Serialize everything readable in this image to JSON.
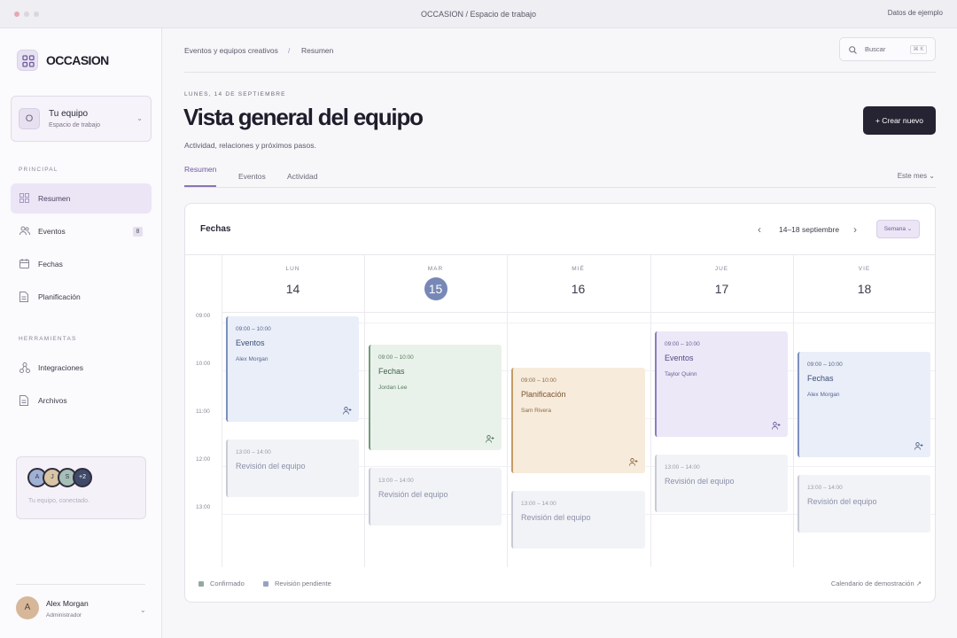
{
  "window": {
    "title": "OCCASION / Espacio de trabajo",
    "right_label": "Datos de ejemplo"
  },
  "sidebar": {
    "logo": "OCCASION",
    "team": {
      "initial": "O",
      "name": "Tu equipo",
      "sub": "Espacio de trabajo"
    },
    "section_principal": "PRINCIPAL",
    "section_tools": "HERRAMIENTAS",
    "items": [
      {
        "label": "Resumen",
        "icon": "grid-icon",
        "active": true
      },
      {
        "label": "Eventos",
        "icon": "users-icon",
        "badge": "8"
      },
      {
        "label": "Fechas",
        "icon": "calendar-icon"
      },
      {
        "label": "Planificación",
        "icon": "document-icon"
      }
    ],
    "tools": [
      {
        "label": "Integraciones",
        "icon": "network-icon"
      },
      {
        "label": "Archivos",
        "icon": "file-icon"
      }
    ],
    "promo": {
      "avatars": [
        "A",
        "J",
        "S",
        "+2"
      ],
      "text": "Tu equipo, conectado."
    },
    "user": {
      "initial": "A",
      "name": "Alex Morgan",
      "role": "Administrador"
    }
  },
  "header": {
    "breadcrumb": [
      "Eventos y equipos creativos",
      "/",
      "Resumen"
    ],
    "search_label": "Buscar",
    "search_kbd": "⌘ K",
    "date": "LUNES, 14 DE SEPTIEMBRE",
    "title": "Vista general del equipo",
    "subtitle": "Actividad, relaciones y próximos pasos.",
    "cta": "+ Crear nuevo"
  },
  "tabs": [
    {
      "label": "Resumen",
      "active": true
    },
    {
      "label": "Eventos"
    },
    {
      "label": "Actividad"
    }
  ],
  "period": "Este mes ⌄",
  "calendar": {
    "title": "Fechas",
    "range": "14–18 septiembre",
    "view": "Semana ⌄",
    "days": [
      {
        "name": "LUN",
        "num": "14"
      },
      {
        "name": "MAR",
        "num": "15",
        "today": true
      },
      {
        "name": "MIÉ",
        "num": "16"
      },
      {
        "name": "JUE",
        "num": "17"
      },
      {
        "name": "VIE",
        "num": "18"
      }
    ],
    "times": [
      "09:00",
      "10:00",
      "11:00",
      "12:00",
      "13:00"
    ],
    "events": [
      {
        "time": "09:00 – 10:00",
        "name": "Eventos",
        "person": "Alex Morgan"
      },
      {
        "time": "09:00 – 10:00",
        "name": "Fechas",
        "person": "Jordan Lee"
      },
      {
        "time": "09:00 – 10:00",
        "name": "Planificación",
        "person": "Sam Rivera"
      },
      {
        "time": "09:00 – 10:00",
        "name": "Eventos",
        "person": "Taylor Quinn"
      },
      {
        "time": "09:00 – 10:00",
        "name": "Fechas",
        "person": "Alex Morgan"
      },
      {
        "time": "13:00 – 14:00",
        "name": "Revisión del equipo"
      },
      {
        "time": "13:00 – 14:00",
        "name": "Revisión del equipo"
      },
      {
        "time": "13:00 – 14:00",
        "name": "Revisión del equipo"
      },
      {
        "time": "13:00 – 14:00",
        "name": "Revisión del equipo"
      },
      {
        "time": "13:00 – 14:00",
        "name": "Revisión del equipo"
      }
    ],
    "legend": [
      {
        "label": "Confirmado",
        "color": "#94a8a0"
      },
      {
        "label": "Revisión pendiente",
        "color": "#98a3bf"
      }
    ],
    "demo_link": "Calendario de demostración ↗"
  }
}
